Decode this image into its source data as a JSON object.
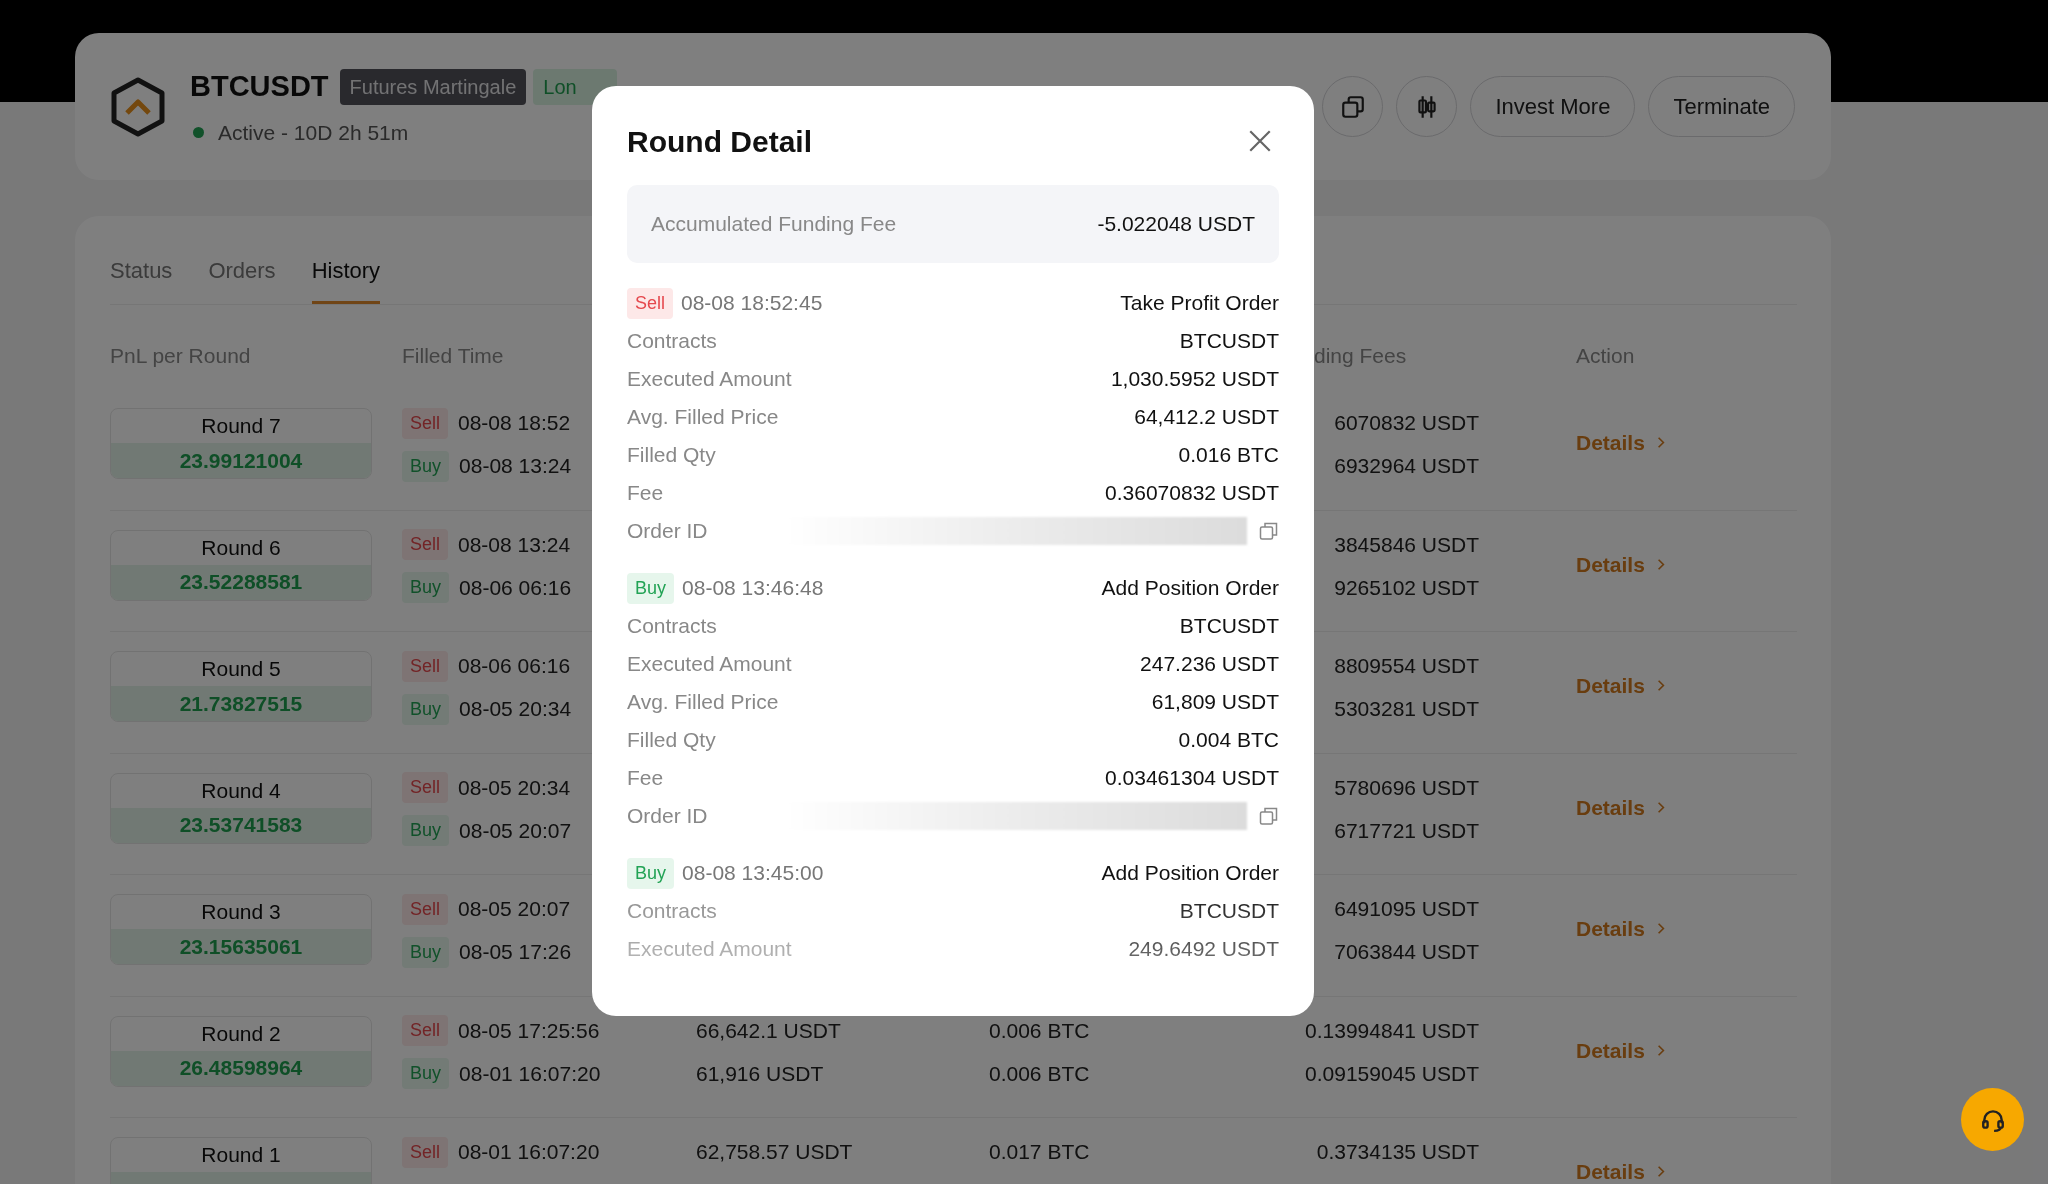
{
  "header": {
    "symbol": "BTCUSDT",
    "badges": [
      {
        "kind": "strategy",
        "text": "Futures Martingale"
      },
      {
        "kind": "direction",
        "text": "Lon"
      }
    ],
    "status": {
      "active": true,
      "text": "Active - 10D 2h 51m"
    },
    "buttons": [
      "Invest More",
      "Terminate"
    ]
  },
  "tabs": [
    {
      "label": "Status",
      "selected": false
    },
    {
      "label": "Orders",
      "selected": false
    },
    {
      "label": "History",
      "selected": true
    }
  ],
  "table": {
    "columns": {
      "pnl": "PnL per Round",
      "time": "Filled Time",
      "fees": "ding Fees",
      "action": "Action"
    },
    "rows": [
      {
        "round": "Round 7",
        "pnl": "23.99121004",
        "action": "Details",
        "orders": [
          {
            "kind": "sell",
            "side": "Sell",
            "time": "08-08 18:52",
            "fee": "6070832 USDT"
          },
          {
            "kind": "buy",
            "side": "Buy",
            "time": "08-08 13:24",
            "fee": "6932964 USDT"
          }
        ]
      },
      {
        "round": "Round 6",
        "pnl": "23.52288581",
        "action": "Details",
        "orders": [
          {
            "kind": "sell",
            "side": "Sell",
            "time": "08-08 13:24",
            "fee": "3845846 USDT"
          },
          {
            "kind": "buy",
            "side": "Buy",
            "time": "08-06 06:16",
            "fee": "9265102 USDT"
          }
        ]
      },
      {
        "round": "Round 5",
        "pnl": "21.73827515",
        "action": "Details",
        "orders": [
          {
            "kind": "sell",
            "side": "Sell",
            "time": "08-06 06:16",
            "fee": "8809554 USDT"
          },
          {
            "kind": "buy",
            "side": "Buy",
            "time": "08-05 20:34",
            "fee": "5303281 USDT"
          }
        ]
      },
      {
        "round": "Round 4",
        "pnl": "23.53741583",
        "action": "Details",
        "orders": [
          {
            "kind": "sell",
            "side": "Sell",
            "time": "08-05 20:34",
            "fee": "5780696 USDT"
          },
          {
            "kind": "buy",
            "side": "Buy",
            "time": "08-05 20:07",
            "fee": "6717721 USDT"
          }
        ]
      },
      {
        "round": "Round 3",
        "pnl": "23.15635061",
        "action": "Details",
        "orders": [
          {
            "kind": "sell",
            "side": "Sell",
            "time": "08-05 20:07",
            "fee": "6491095 USDT"
          },
          {
            "kind": "buy",
            "side": "Buy",
            "time": "08-05 17:26",
            "fee": "7063844 USDT"
          }
        ]
      },
      {
        "round": "Round 2",
        "pnl": "26.48598964",
        "action": "Details",
        "orders": [
          {
            "kind": "sell",
            "side": "Sell",
            "time": "08-05 17:25:56",
            "price": "66,642.1 USDT",
            "qty": "0.006 BTC",
            "fee": "0.13994841 USDT"
          },
          {
            "kind": "buy",
            "side": "Buy",
            "time": "08-01 16:07:20",
            "price": "61,916 USDT",
            "qty": "0.006 BTC",
            "fee": "0.09159045 USDT"
          }
        ]
      },
      {
        "round": "Round 1",
        "action": "Details",
        "orders": [
          {
            "kind": "sell",
            "side": "Sell",
            "time": "08-01 16:07:20",
            "price": "62,758.57 USDT",
            "qty": "0.017 BTC",
            "fee": "0.3734135 USDT"
          }
        ]
      }
    ]
  },
  "modal": {
    "title": "Round Detail",
    "summary": {
      "label": "Accumulated Funding Fee",
      "value": "-5.022048 USDT"
    },
    "orders": [
      {
        "kind": "sell",
        "side": "Sell",
        "time": "08-08 18:52:45",
        "type": "Take Profit Order",
        "fields": [
          {
            "label": "Contracts",
            "value": "BTCUSDT"
          },
          {
            "label": "Executed Amount",
            "value": "1,030.5952 USDT"
          },
          {
            "label": "Avg. Filled Price",
            "value": "64,412.2 USDT"
          },
          {
            "label": "Filled Qty",
            "value": "0.016 BTC"
          },
          {
            "label": "Fee",
            "value": "0.36070832 USDT"
          },
          {
            "label": "Order ID",
            "kind": "redacted"
          }
        ]
      },
      {
        "kind": "buy",
        "side": "Buy",
        "time": "08-08 13:46:48",
        "type": "Add Position Order",
        "fields": [
          {
            "label": "Contracts",
            "value": "BTCUSDT"
          },
          {
            "label": "Executed Amount",
            "value": "247.236 USDT"
          },
          {
            "label": "Avg. Filled Price",
            "value": "61,809 USDT"
          },
          {
            "label": "Filled Qty",
            "value": "0.004 BTC"
          },
          {
            "label": "Fee",
            "value": "0.03461304 USDT"
          },
          {
            "label": "Order ID",
            "kind": "redacted"
          }
        ]
      },
      {
        "kind": "buy",
        "side": "Buy",
        "time": "08-08 13:45:00",
        "type": "Add Position Order",
        "fields": [
          {
            "label": "Contracts",
            "value": "BTCUSDT"
          },
          {
            "label": "Executed Amount",
            "value": "249.6492 USDT"
          }
        ]
      }
    ]
  }
}
